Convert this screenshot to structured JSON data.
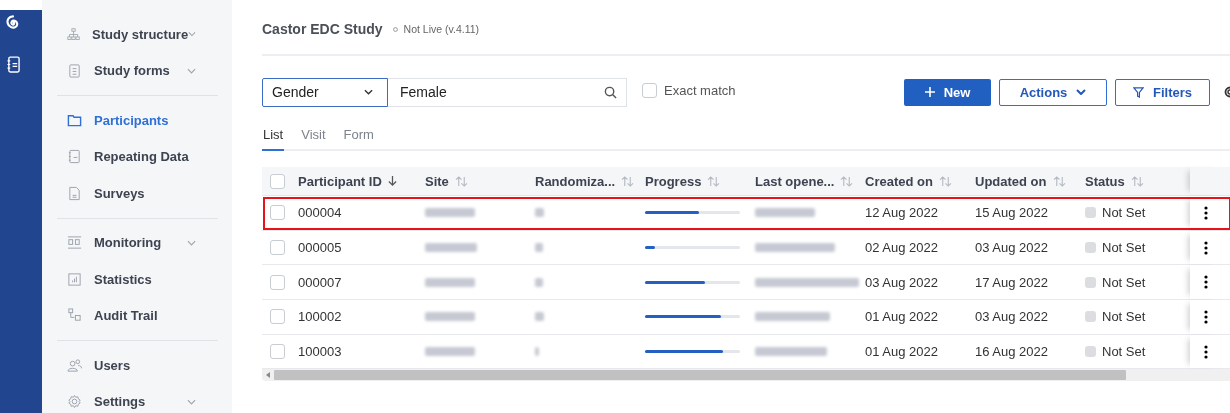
{
  "sidebar": {
    "groups": [
      {
        "items": [
          {
            "label": "Study structure",
            "selected": false,
            "expandable": true
          },
          {
            "label": "Study forms",
            "selected": false,
            "expandable": true
          }
        ]
      },
      {
        "items": [
          {
            "label": "Participants",
            "selected": true,
            "expandable": false
          },
          {
            "label": "Repeating Data",
            "selected": false,
            "expandable": false
          },
          {
            "label": "Surveys",
            "selected": false,
            "expandable": false
          }
        ]
      },
      {
        "items": [
          {
            "label": "Monitoring",
            "selected": false,
            "expandable": true
          },
          {
            "label": "Statistics",
            "selected": false,
            "expandable": false
          },
          {
            "label": "Audit Trail",
            "selected": false,
            "expandable": false
          }
        ]
      },
      {
        "items": [
          {
            "label": "Users",
            "selected": false,
            "expandable": false
          },
          {
            "label": "Settings",
            "selected": false,
            "expandable": true
          }
        ]
      }
    ]
  },
  "header": {
    "title": "Castor EDC Study",
    "status": "Not Live (v.4.11)"
  },
  "filter": {
    "field": "Gender",
    "value": "Female",
    "exact_match_label": "Exact match",
    "exact_match_checked": false
  },
  "buttons": {
    "new": "New",
    "actions": "Actions",
    "filters": "Filters"
  },
  "tabs": [
    {
      "label": "List",
      "selected": true
    },
    {
      "label": "Visit",
      "selected": false
    },
    {
      "label": "Form",
      "selected": false
    }
  ],
  "table": {
    "select_all_checked": false,
    "columns": [
      {
        "label": "Participant ID",
        "sorted": true
      },
      {
        "label": "Site",
        "sorted": false
      },
      {
        "label": "Randomiza...",
        "sorted": false
      },
      {
        "label": "Progress",
        "sorted": false
      },
      {
        "label": "Last opene...",
        "sorted": false
      },
      {
        "label": "Created on",
        "sorted": false
      },
      {
        "label": "Updated on",
        "sorted": false
      },
      {
        "label": "Status",
        "sorted": false
      }
    ],
    "rows": [
      {
        "id": "000004",
        "progress": {
          "level": 0.57
        },
        "created": "12 Aug 2022",
        "updated": "15 Aug 2022",
        "status": "Not Set",
        "checked": false,
        "highlighted": true
      },
      {
        "id": "000005",
        "progress": {
          "level": 0.1
        },
        "created": "02 Aug 2022",
        "updated": "03 Aug 2022",
        "status": "Not Set",
        "checked": false,
        "highlighted": false
      },
      {
        "id": "000007",
        "progress": {
          "level": 0.63
        },
        "created": "03 Aug 2022",
        "updated": "17 Aug 2022",
        "status": "Not Set",
        "checked": false,
        "highlighted": false
      },
      {
        "id": "100002",
        "progress": {
          "level": 0.8
        },
        "created": "01 Aug 2022",
        "updated": "03 Aug 2022",
        "status": "Not Set",
        "checked": false,
        "highlighted": false
      },
      {
        "id": "100003",
        "progress": {
          "level": 0.82
        },
        "created": "01 Aug 2022",
        "updated": "16 Aug 2022",
        "status": "Not Set",
        "checked": false,
        "highlighted": false
      }
    ]
  }
}
